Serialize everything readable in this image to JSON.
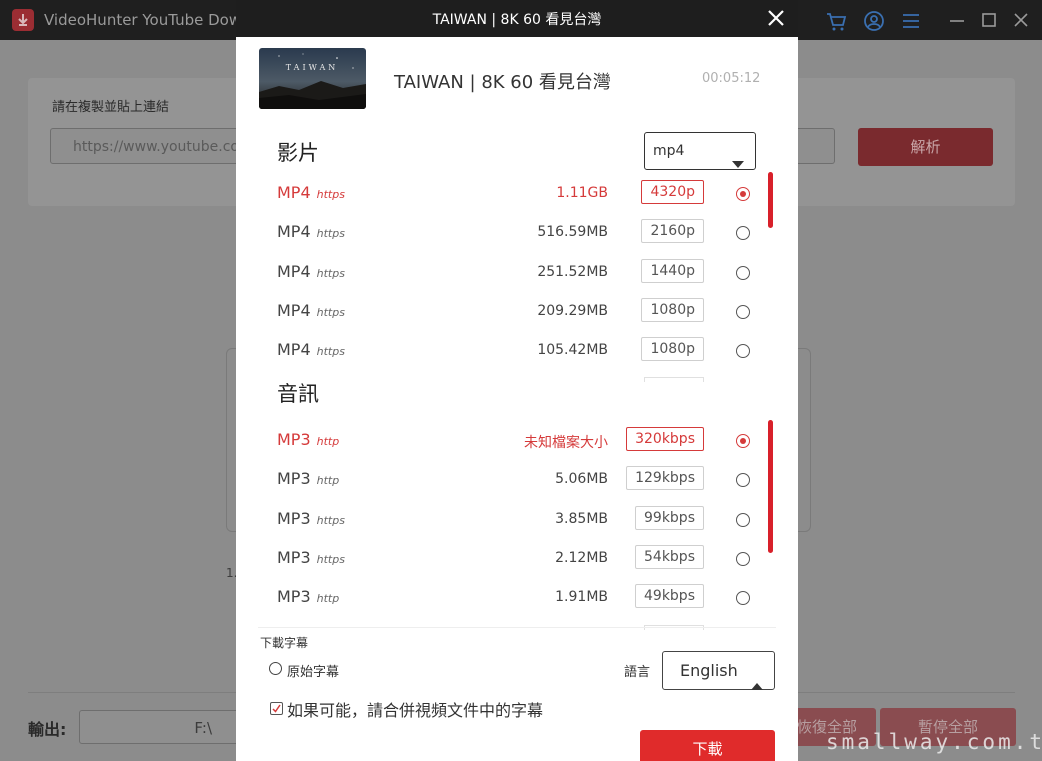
{
  "app": {
    "title": "VideoHunter YouTube Downlo",
    "paste_label": "請在複製並貼上連結",
    "url_placeholder": "https://www.youtube.com",
    "parse_button": "解析",
    "stray_text": "1.",
    "output_label": "輸出:",
    "output_path": "F:\\",
    "resume_all_button": "恢復全部",
    "pause_all_button": "暫停全部"
  },
  "watermark": "smallway.com.tw",
  "dialog": {
    "title": "TAIWAN | 8K 60 看見台灣",
    "thumbnail_text": "TAIWAN",
    "video_title": "TAIWAN | 8K 60 看見台灣",
    "duration": "00:05:12",
    "video_section": {
      "title": "影片",
      "format_selected": "mp4",
      "rows": [
        {
          "format": "MP4",
          "protocol": "https",
          "size": "1.11GB",
          "quality": "4320p",
          "selected": true
        },
        {
          "format": "MP4",
          "protocol": "https",
          "size": "516.59MB",
          "quality": "2160p",
          "selected": false
        },
        {
          "format": "MP4",
          "protocol": "https",
          "size": "251.52MB",
          "quality": "1440p",
          "selected": false
        },
        {
          "format": "MP4",
          "protocol": "https",
          "size": "209.29MB",
          "quality": "1080p",
          "selected": false
        },
        {
          "format": "MP4",
          "protocol": "https",
          "size": "105.42MB",
          "quality": "1080p",
          "selected": false
        }
      ]
    },
    "audio_section": {
      "title": "音訊",
      "rows": [
        {
          "format": "MP3",
          "protocol": "http",
          "size": "未知檔案大小",
          "quality": "320kbps",
          "selected": true
        },
        {
          "format": "MP3",
          "protocol": "http",
          "size": "5.06MB",
          "quality": "129kbps",
          "selected": false
        },
        {
          "format": "MP3",
          "protocol": "https",
          "size": "3.85MB",
          "quality": "99kbps",
          "selected": false
        },
        {
          "format": "MP3",
          "protocol": "https",
          "size": "2.12MB",
          "quality": "54kbps",
          "selected": false
        },
        {
          "format": "MP3",
          "protocol": "http",
          "size": "1.91MB",
          "quality": "49kbps",
          "selected": false
        }
      ]
    },
    "subtitles": {
      "label": "下載字幕",
      "original_option": "原始字幕",
      "language_label": "語言",
      "language_selected": "English",
      "merge_option": "如果可能，請合併視頻文件中的字幕",
      "merge_checked": true
    },
    "download_button": "下載"
  },
  "colors": {
    "accent": "#e02b2b",
    "selected_text": "#d53a3a",
    "header_bg": "#1e1e1e"
  }
}
